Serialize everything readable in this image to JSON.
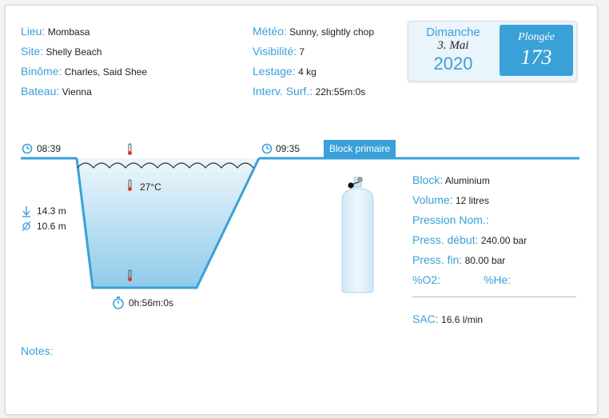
{
  "info_left": [
    {
      "label": "Lieu:",
      "value": "Mombasa"
    },
    {
      "label": "Site:",
      "value": "Shelly Beach"
    },
    {
      "label": "Binôme:",
      "value": "Charles, Said Shee"
    },
    {
      "label": "Bateau:",
      "value": "Vienna"
    }
  ],
  "info_mid": [
    {
      "label": "Météo:",
      "value": "Sunny, slightly chop"
    },
    {
      "label": "Visibilité:",
      "value": "7"
    },
    {
      "label": "Lestage:",
      "value": "4 kg"
    },
    {
      "label": "Interv. Surf.:",
      "value": "22h:55m:0s"
    }
  ],
  "date": {
    "day_name": "Dimanche",
    "day_month": "3. Mai",
    "year": "2020"
  },
  "dive": {
    "label": "Plongée",
    "number": "173"
  },
  "profile": {
    "start_time": "08:39",
    "end_time": "09:35",
    "max_depth": "14.3 m",
    "avg_depth": "10.6 m",
    "water_temp": "27°C",
    "duration": "0h:56m:0s"
  },
  "block": {
    "badge": "Block primaire",
    "block_label": "Block:",
    "block_value": "Aluminium",
    "volume_label": "Volume:",
    "volume_value": "12 litres",
    "pression_nom_label": "Pression Nom.:",
    "pression_debut_label": "Press. début:",
    "pression_debut_value": "240.00 bar",
    "pression_fin_label": "Press. fin:",
    "pression_fin_value": "80.00 bar",
    "o2_label": "%O2:",
    "he_label": "%He:",
    "sac_label": "SAC:",
    "sac_value": "16.6 l/min"
  },
  "notes_label": "Notes:",
  "colors": {
    "accent": "#3aa0d8",
    "water_top": "#eef7fc",
    "water_bottom": "#8ecbe9"
  }
}
